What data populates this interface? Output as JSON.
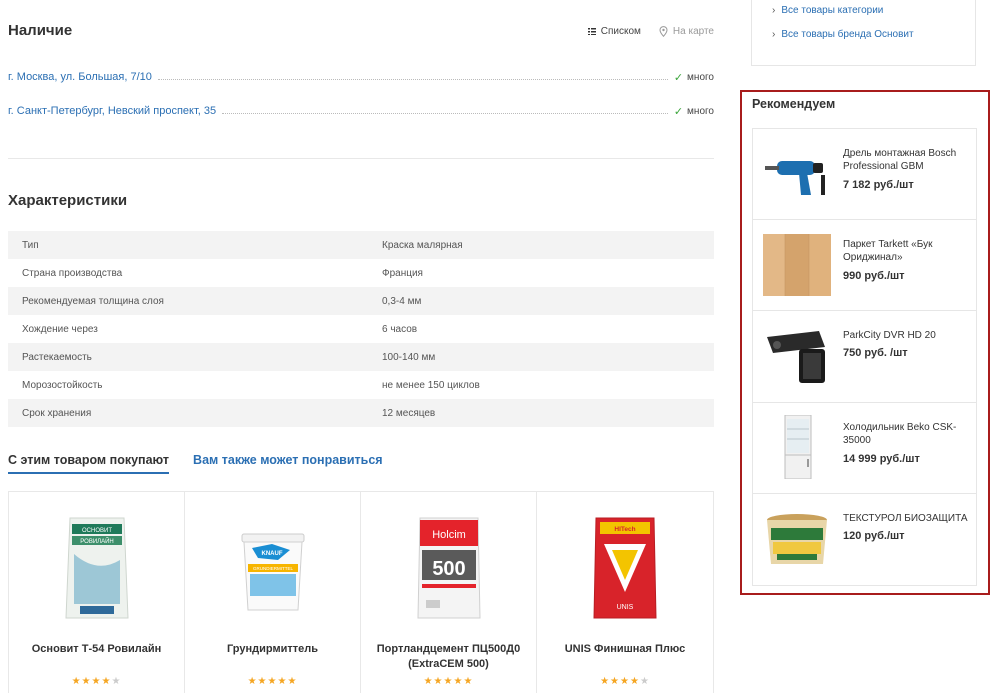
{
  "availability": {
    "title": "Наличие",
    "view_list_label": "Списком",
    "view_map_label": "На карте",
    "stores": [
      {
        "address": "г. Москва, ул. Большая, 7/10",
        "stock": "много"
      },
      {
        "address": "г. Санкт-Петербург, Невский проспект, 35",
        "stock": "много"
      }
    ]
  },
  "specs": {
    "title": "Характеристики",
    "rows": [
      {
        "key": "Тип",
        "value": "Краска малярная"
      },
      {
        "key": "Страна производства",
        "value": "Франция"
      },
      {
        "key": "Рекомендуемая толщина слоя",
        "value": "0,3-4 мм"
      },
      {
        "key": "Хождение через",
        "value": "6 часов"
      },
      {
        "key": "Растекаемость",
        "value": "100-140 мм"
      },
      {
        "key": "Морозостойкость",
        "value": "не менее 150 циклов"
      },
      {
        "key": "Срок хранения",
        "value": "12 месяцев"
      }
    ]
  },
  "tabs": {
    "bought_together": "С этим товаром покупают",
    "you_may_like": "Вам также может понравиться"
  },
  "products": [
    {
      "name": "Основит Т-54 Ровилайн",
      "rating": 4,
      "image_label": "РОВИЛАЙН",
      "brand": "ОСНОВИТ"
    },
    {
      "name": "Грундирмиттель",
      "rating": 5,
      "image_label": "GRUNDIERMITTEL",
      "brand": "KNAUF"
    },
    {
      "name": "Портландцемент ПЦ500Д0 (ExtraCEM 500)",
      "rating": 5,
      "image_label": "500",
      "brand": "Holcim"
    },
    {
      "name": "UNIS Финишная Плюс",
      "rating": 4,
      "image_label": "HITech",
      "brand": "UNIS"
    }
  ],
  "sidebar": {
    "links": [
      {
        "label": "Все товары категории"
      },
      {
        "label": "Все товары бренда Основит"
      }
    ],
    "recommend_title": "Рекомендуем",
    "recommendations": [
      {
        "title": "Дрель монтажная Bosch Professional GBM",
        "price": "7 182 руб./шт",
        "icon": "drill-image"
      },
      {
        "title": "Паркет Tarkett «Бук Ориджинал»",
        "price": "990 руб./шт",
        "icon": "parquet-image"
      },
      {
        "title": "ParkCity DVR HD 20",
        "price": "750 руб. /шт",
        "icon": "dvr-camera-image"
      },
      {
        "title": "Холодильник Beko CSK-35000",
        "price": "14 999 руб./шт",
        "icon": "fridge-image"
      },
      {
        "title": "ТЕКСТУРОЛ БИОЗАЩИТА",
        "price": "120 руб./шт",
        "icon": "paint-bucket-image"
      }
    ]
  },
  "colors": {
    "link": "#2b6fb3",
    "in_stock_check": "#3aa53a",
    "star_on": "#f5a623",
    "highlight_border": "#a81c1c"
  }
}
